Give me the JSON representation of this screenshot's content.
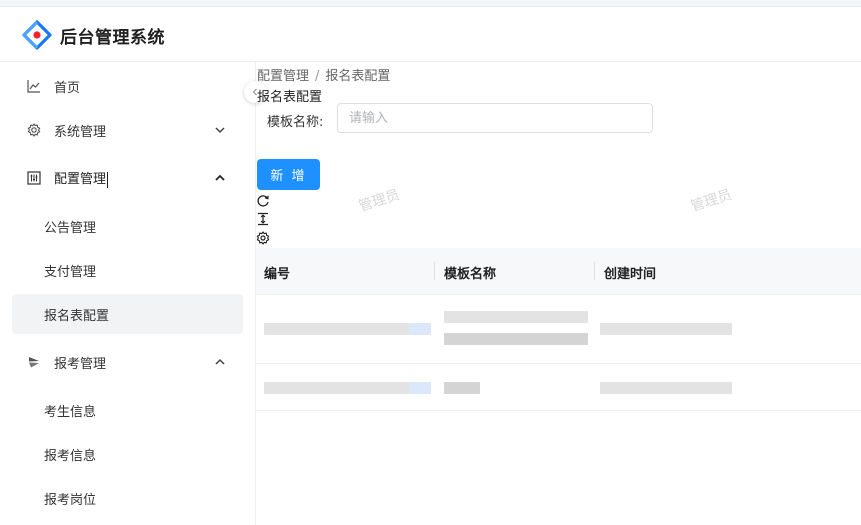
{
  "app": {
    "title": "后台管理系统"
  },
  "sidebar": {
    "items": [
      {
        "label": "首页"
      },
      {
        "label": "系统管理"
      },
      {
        "label": "配置管理"
      },
      {
        "label": "报考管理"
      }
    ],
    "config_sub": [
      {
        "label": "公告管理"
      },
      {
        "label": "支付管理"
      },
      {
        "label": "报名表配置",
        "active": true
      }
    ],
    "exam_sub": [
      {
        "label": "考生信息"
      },
      {
        "label": "报考信息"
      },
      {
        "label": "报考岗位"
      }
    ]
  },
  "breadcrumb": {
    "parent": "配置管理",
    "separator": "/",
    "current": "报名表配置"
  },
  "page": {
    "title": "报名表配置"
  },
  "search": {
    "label": "模板名称:",
    "placeholder": "请输入",
    "value": ""
  },
  "toolbar": {
    "add_label": "新 增"
  },
  "watermark": {
    "text": "管理员"
  },
  "table": {
    "columns": [
      "编号",
      "模板名称",
      "创建时间"
    ]
  },
  "colors": {
    "accent": "#1e90ff",
    "active_bg": "#f2f3f5"
  }
}
